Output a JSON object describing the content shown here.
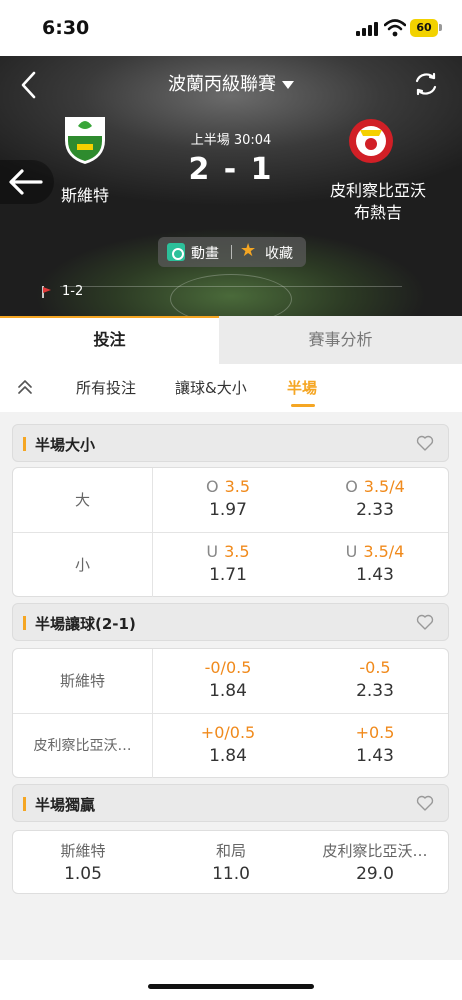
{
  "status_bar": {
    "time": "6:30",
    "battery": "60"
  },
  "match": {
    "league": "波蘭丙級聯賽",
    "period": "上半場 30:04",
    "score": "2 - 1",
    "home_team": "斯維特",
    "away_team_line1": "皮利察比亞沃",
    "away_team_line2": "布熱吉",
    "animation_label": "動畫",
    "favorite_label": "收藏",
    "corners": "1-2"
  },
  "main_tabs": {
    "bet": "投注",
    "analysis": "賽事分析"
  },
  "sub_tabs": {
    "all": "所有投注",
    "handicap_ou": "讓球&大小",
    "half": "半場"
  },
  "markets": {
    "half_ou": {
      "title": "半場大小",
      "rows": [
        {
          "label": "大",
          "pre": "O",
          "line1": "3.5",
          "price1": "1.97",
          "line2": "3.5/4",
          "price2": "2.33"
        },
        {
          "label": "小",
          "pre": "U",
          "line1": "3.5",
          "price1": "1.71",
          "line2": "3.5/4",
          "price2": "1.43"
        }
      ]
    },
    "half_handicap": {
      "title": "半場讓球(2-1)",
      "rows": [
        {
          "label": "斯維特",
          "line1": "-0/0.5",
          "price1": "1.84",
          "line2": "-0.5",
          "price2": "2.33"
        },
        {
          "label": "皮利察比亞沃…",
          "line1": "+0/0.5",
          "price1": "1.84",
          "line2": "+0.5",
          "price2": "1.43"
        }
      ]
    },
    "half_1x2": {
      "title": "半場獨贏",
      "cols": [
        {
          "name": "斯維特",
          "price": "1.05"
        },
        {
          "name": "和局",
          "price": "11.0"
        },
        {
          "name": "皮利察比亞沃…",
          "price": "29.0"
        }
      ]
    }
  },
  "colors": {
    "accent": "#f5a623",
    "odds_line": "#f08a1c",
    "animation_green": "#2cc09a"
  }
}
